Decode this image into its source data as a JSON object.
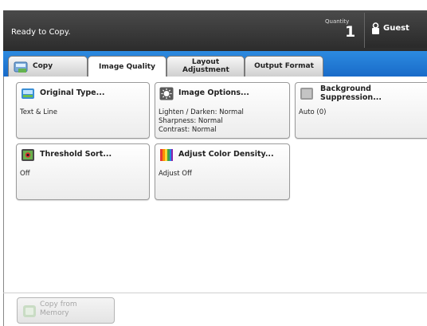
{
  "header": {
    "status_text": "Ready to Copy.",
    "quantity_label": "Quantity",
    "quantity_value": "1",
    "user_button_label": "Guest"
  },
  "tabs": [
    {
      "label": "Copy",
      "icon": "copy-icon",
      "active": false
    },
    {
      "label": "Image Quality",
      "active": true
    },
    {
      "label": "Layout Adjustment",
      "active": false
    },
    {
      "label": "Output Format",
      "active": false
    }
  ],
  "features": {
    "original_type": {
      "title": "Original Type...",
      "value": "Text & Line",
      "icon": "original-type-icon"
    },
    "image_options": {
      "title": "Image Options...",
      "values": [
        "Lighten / Darken: Normal",
        "Sharpness: Normal",
        "Contrast: Normal"
      ],
      "icon": "image-options-icon"
    },
    "background_suppression": {
      "title": "Background Suppression...",
      "value": "Auto (0)",
      "icon": "background-suppression-icon"
    },
    "threshold_sort": {
      "title": "Threshold Sort...",
      "value": "Off",
      "icon": "threshold-sort-icon"
    },
    "adjust_color_density": {
      "title": "Adjust Color Density...",
      "value": "Adjust Off",
      "icon": "color-density-icon"
    }
  },
  "copy_from_memory": {
    "label": "Copy from Memory",
    "enabled": false,
    "icon": "memory-icon"
  },
  "colors": {
    "accent_blue": "#1f78d1",
    "header_dark": "#3a3a3a"
  }
}
